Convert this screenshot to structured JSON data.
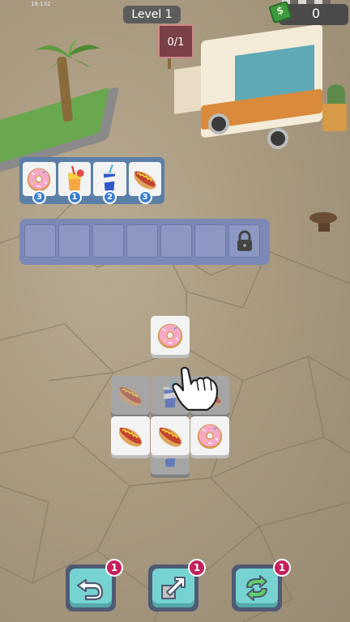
{
  "hud": {
    "clock": "18:132",
    "level": "Level 1",
    "coins": "0",
    "sign_progress": "0/1"
  },
  "order": {
    "items": [
      {
        "item": "donut",
        "count": "3"
      },
      {
        "item": "juice",
        "count": "1"
      },
      {
        "item": "soda",
        "count": "2"
      },
      {
        "item": "hotdog",
        "count": "3"
      }
    ]
  },
  "tray": {
    "slot_count": 7,
    "locked_slot_icon": "padlock-icon"
  },
  "board": {
    "tiles": [
      {
        "item": "donut",
        "state": "active",
        "layer": "top"
      },
      {
        "item": "hotdog",
        "state": "dim",
        "layer": "middle"
      },
      {
        "item": "soda",
        "state": "dim",
        "layer": "middle"
      },
      {
        "item": "hotdog",
        "state": "dim",
        "layer": "middle"
      },
      {
        "item": "hotdog",
        "state": "active",
        "layer": "bottom"
      },
      {
        "item": "hotdog",
        "state": "active",
        "layer": "bottom"
      },
      {
        "item": "donut",
        "state": "active",
        "layer": "bottom"
      },
      {
        "item": "soda",
        "state": "dim",
        "layer": "bottom"
      }
    ]
  },
  "buttons": {
    "undo": {
      "icon": "undo-icon",
      "count": "1"
    },
    "return": {
      "icon": "return-arrow-icon",
      "count": "1"
    },
    "shuffle": {
      "icon": "shuffle-icon",
      "count": "1"
    }
  },
  "colors": {
    "order_panel": "#5b7fa6",
    "badge_blue": "#3b7fd1",
    "booster_badge": "#c4205c",
    "booster_button": "#76d3d2"
  }
}
